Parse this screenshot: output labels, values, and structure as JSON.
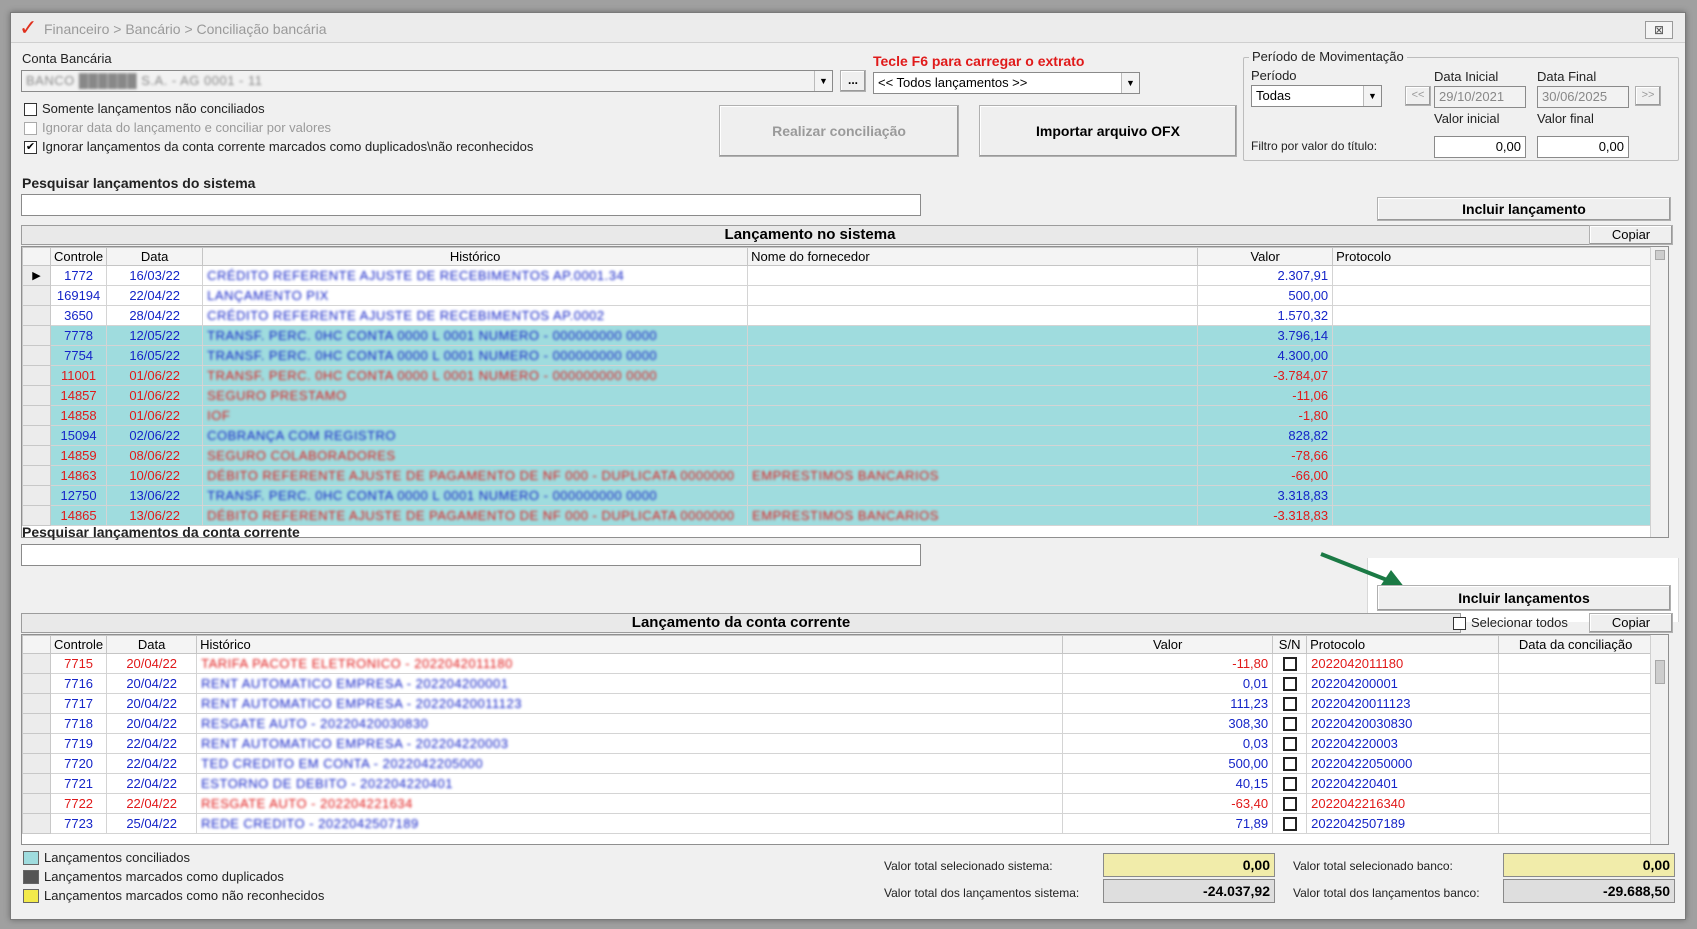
{
  "window": {
    "breadcrumb": "Financeiro > Bancário > Conciliação bancária",
    "logo_glyph": "✓",
    "close_glyph": "⊠"
  },
  "filters": {
    "conta_label": "Conta Bancária",
    "conta_value": "BANCO ██████ S.A. - AG 0001 - 11",
    "ellipsis": "...",
    "f6_hint": "Tecle F6 para carregar o extrato",
    "lancamentos_value": "<< Todos lançamentos >>",
    "chk_nao_conciliados": "Somente lançamentos não conciliados",
    "chk_ignorar_data": "Ignorar data do lançamento e conciliar por valores",
    "chk_ignorar_duplicados": "Ignorar lançamentos da conta corrente marcados como duplicados\\não reconhecidos",
    "chk_ignorar_duplicados_checked": "✔",
    "btn_realizar": "Realizar conciliação",
    "btn_importar": "Importar arquivo OFX"
  },
  "periodo": {
    "group_label": "Período de Movimentação",
    "periodo_label": "Período",
    "periodo_value": "Todas",
    "prev_glyph": "<<",
    "next_glyph": ">>",
    "data_inicial_label": "Data Inicial",
    "data_inicial_value": "29/10/2021",
    "data_final_label": "Data Final",
    "data_final_value": "30/06/2025",
    "valor_inicial_label": "Valor inicial",
    "valor_final_label": "Valor final",
    "filtro_label": "Filtro por valor do título:",
    "valor_inicial_value": "0,00",
    "valor_final_value": "0,00"
  },
  "sistema": {
    "search_label": "Pesquisar lançamentos do sistema",
    "incluir_btn": "Incluir lançamento",
    "header": "Lançamento no sistema",
    "copiar": "Copiar",
    "row_indicator": "▶",
    "columns": [
      "Controle",
      "Data",
      "Histórico",
      "Nome do fornecedor",
      "Valor",
      "Protocolo"
    ],
    "rows": [
      {
        "controle": "1772",
        "data": "16/03/22",
        "historico": "CRÉDITO REFERENTE AJUSTE DE RECEBIMENTOS AP.0001.34",
        "fornecedor": "",
        "valor": "2.307,91",
        "color": "blue",
        "conc": false
      },
      {
        "controle": "169194",
        "data": "22/04/22",
        "historico": "LANÇAMENTO PIX",
        "fornecedor": "",
        "valor": "500,00",
        "color": "blue",
        "conc": false
      },
      {
        "controle": "3650",
        "data": "28/04/22",
        "historico": "CRÉDITO REFERENTE AJUSTE DE RECEBIMENTOS AP.0002",
        "fornecedor": "",
        "valor": "1.570,32",
        "color": "blue",
        "conc": false
      },
      {
        "controle": "7778",
        "data": "12/05/22",
        "historico": "TRANSF. PERC. 0HC CONTA 0000 L 0001 NUMERO - 000000000 0000",
        "fornecedor": "",
        "valor": "3.796,14",
        "color": "blue",
        "conc": true
      },
      {
        "controle": "7754",
        "data": "16/05/22",
        "historico": "TRANSF. PERC. 0HC CONTA 0000 L 0001 NUMERO - 000000000 0000",
        "fornecedor": "",
        "valor": "4.300,00",
        "color": "blue",
        "conc": true
      },
      {
        "controle": "11001",
        "data": "01/06/22",
        "historico": "TRANSF. PERC. 0HC CONTA 0000 L 0001 NUMERO - 000000000 0000",
        "fornecedor": "",
        "valor": "-3.784,07",
        "color": "red",
        "conc": true
      },
      {
        "controle": "14857",
        "data": "01/06/22",
        "historico": "SEGURO PRESTAMO",
        "fornecedor": "",
        "valor": "-11,06",
        "color": "red",
        "conc": true
      },
      {
        "controle": "14858",
        "data": "01/06/22",
        "historico": "IOF",
        "fornecedor": "",
        "valor": "-1,80",
        "color": "red",
        "conc": true
      },
      {
        "controle": "15094",
        "data": "02/06/22",
        "historico": "COBRANÇA COM REGISTRO",
        "fornecedor": "",
        "valor": "828,82",
        "color": "blue",
        "conc": true
      },
      {
        "controle": "14859",
        "data": "08/06/22",
        "historico": "SEGURO COLABORADORES",
        "fornecedor": "",
        "valor": "-78,66",
        "color": "red",
        "conc": true
      },
      {
        "controle": "14863",
        "data": "10/06/22",
        "historico": "DÉBITO REFERENTE AJUSTE DE PAGAMENTO DE NF 000 - DUPLICATA 0000000",
        "fornecedor": "EMPRESTIMOS BANCARIOS",
        "valor": "-66,00",
        "color": "red",
        "conc": true
      },
      {
        "controle": "12750",
        "data": "13/06/22",
        "historico": "TRANSF. PERC. 0HC CONTA 0000 L 0001 NUMERO - 000000000 0000",
        "fornecedor": "",
        "valor": "3.318,83",
        "color": "blue",
        "conc": true
      },
      {
        "controle": "14865",
        "data": "13/06/22",
        "historico": "DÉBITO REFERENTE AJUSTE DE PAGAMENTO DE NF 000 - DUPLICATA 0000000",
        "fornecedor": "EMPRESTIMOS BANCARIOS",
        "valor": "-3.318,83",
        "color": "red",
        "conc": true
      }
    ]
  },
  "conta": {
    "search_label": "Pesquisar lançamentos da conta corrente",
    "incluir_btn": "Incluir lançamentos",
    "selecionar_todos": "Selecionar todos",
    "copiar": "Copiar",
    "header": "Lançamento da conta corrente",
    "columns": [
      "Controle",
      "Data",
      "Histórico",
      "Valor",
      "S/N",
      "Protocolo",
      "Data da conciliação"
    ],
    "rows": [
      {
        "controle": "7715",
        "data": "20/04/22",
        "historico": "TARIFA PACOTE ELETRONICO - 2022042011180",
        "valor": "-11,80",
        "protocolo": "2022042011180",
        "color": "red"
      },
      {
        "controle": "7716",
        "data": "20/04/22",
        "historico": "RENT AUTOMATICO EMPRESA - 202204200001",
        "valor": "0,01",
        "protocolo": "202204200001",
        "color": "blue"
      },
      {
        "controle": "7717",
        "data": "20/04/22",
        "historico": "RENT AUTOMATICO EMPRESA - 20220420011123",
        "valor": "111,23",
        "protocolo": "20220420011123",
        "color": "blue"
      },
      {
        "controle": "7718",
        "data": "20/04/22",
        "historico": "RESGATE AUTO - 20220420030830",
        "valor": "308,30",
        "protocolo": "20220420030830",
        "color": "blue"
      },
      {
        "controle": "7719",
        "data": "22/04/22",
        "historico": "RENT AUTOMATICO EMPRESA - 202204220003",
        "valor": "0,03",
        "protocolo": "202204220003",
        "color": "blue"
      },
      {
        "controle": "7720",
        "data": "22/04/22",
        "historico": "TED CREDITO EM CONTA - 2022042205000",
        "valor": "500,00",
        "protocolo": "20220422050000",
        "color": "blue"
      },
      {
        "controle": "7721",
        "data": "22/04/22",
        "historico": "ESTORNO DE DEBITO - 202204220401",
        "valor": "40,15",
        "protocolo": "202204220401",
        "color": "blue"
      },
      {
        "controle": "7722",
        "data": "22/04/22",
        "historico": "RESGATE AUTO - 202204221634",
        "valor": "-63,40",
        "protocolo": "2022042216340",
        "color": "red"
      },
      {
        "controle": "7723",
        "data": "25/04/22",
        "historico": "REDE CREDITO - 2022042507189",
        "valor": "71,89",
        "protocolo": "2022042507189",
        "color": "blue"
      }
    ]
  },
  "legend": {
    "conciliados": "Lançamentos conciliados",
    "duplicados": "Lançamentos marcados como duplicados",
    "nao_reconhecidos": "Lançamentos marcados como não reconhecidos",
    "colors": {
      "conciliados": "#9fdcde",
      "duplicados": "#555555",
      "nao_reconhecidos": "#f2ea4a"
    }
  },
  "totals": {
    "sel_sistema_label": "Valor total selecionado sistema:",
    "sel_sistema_value": "0,00",
    "total_sistema_label": "Valor total dos lançamentos sistema:",
    "total_sistema_value": "-24.037,92",
    "sel_banco_label": "Valor total selecionado banco:",
    "sel_banco_value": "0,00",
    "total_banco_label": "Valor total dos lançamentos banco:",
    "total_banco_value": "-29.688,50"
  }
}
